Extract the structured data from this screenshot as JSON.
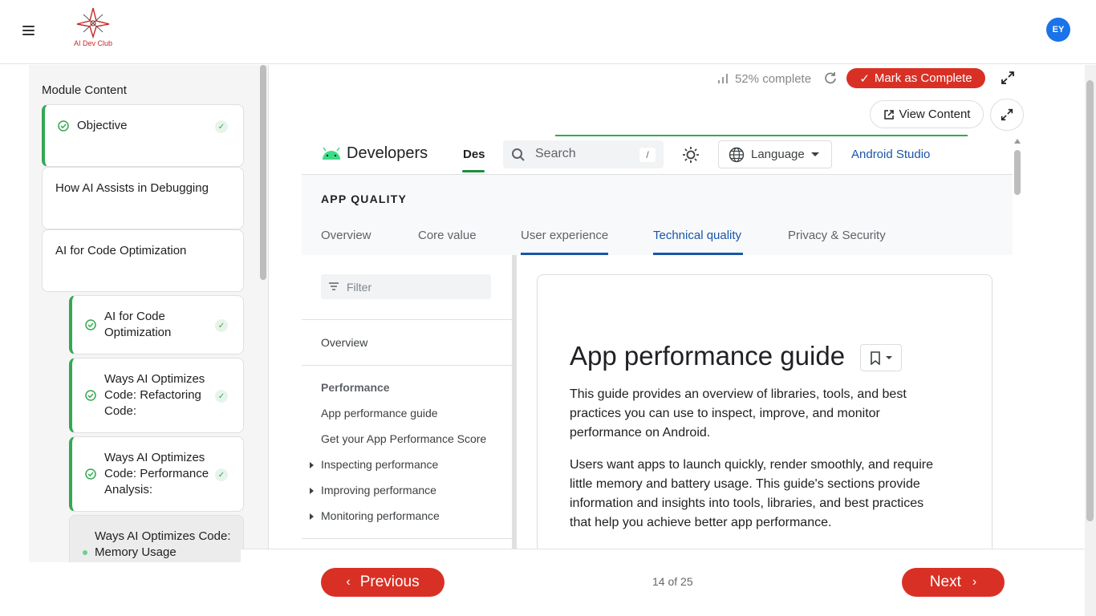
{
  "header": {
    "logo_text": "AI Dev Club",
    "avatar_initials": "EY"
  },
  "sidebar": {
    "title": "Module Content",
    "items": [
      {
        "label": "Objective",
        "state": "completed"
      },
      {
        "label": "How AI Assists in Debugging",
        "state": "section"
      },
      {
        "label": "AI for Code Optimization",
        "state": "section"
      },
      {
        "label": "AI for Code Optimization",
        "state": "completed"
      },
      {
        "label": "Ways AI Optimizes Code: Refactoring Code:",
        "state": "completed"
      },
      {
        "label": "Ways AI Optimizes Code: Performance Analysis:",
        "state": "completed"
      },
      {
        "label": "Ways AI Optimizes Code: Memory Usage",
        "state": "current"
      }
    ],
    "tick": "✓"
  },
  "progress": {
    "percent_text": "52% complete",
    "percent": 52
  },
  "actions": {
    "mark_complete": "Mark as Complete",
    "view_content": "View Content"
  },
  "embedded": {
    "brand": "Developers",
    "tab_des": "Des",
    "search_placeholder": "Search",
    "search_shortcut": "/",
    "language": "Language",
    "android_studio": "Android Studio",
    "section_title": "APP QUALITY",
    "tabs": [
      "Overview",
      "Core value",
      "User experience",
      "Technical quality",
      "Privacy & Security"
    ],
    "active_tab": "Technical quality",
    "filter_placeholder": "Filter",
    "nav": {
      "overview": "Overview",
      "performance_head": "Performance",
      "items": [
        "App performance guide",
        "Get your App Performance Score",
        "Inspecting performance",
        "Improving performance",
        "Monitoring performance"
      ]
    },
    "article": {
      "title": "App performance guide",
      "p1": "This guide provides an overview of libraries, tools, and best practices you can use to inspect, improve, and monitor performance on Android.",
      "p2": "Users want apps to launch quickly, render smoothly, and require little memory and battery usage. This guide's sections provide information and insights into tools, libraries, and best practices that help you achieve better app performance."
    }
  },
  "pager": {
    "previous": "Previous",
    "next": "Next",
    "count": "14 of 25"
  },
  "colors": {
    "brand_red": "#d93025",
    "complete_green": "#34a853",
    "link_blue": "#1a56a8"
  }
}
